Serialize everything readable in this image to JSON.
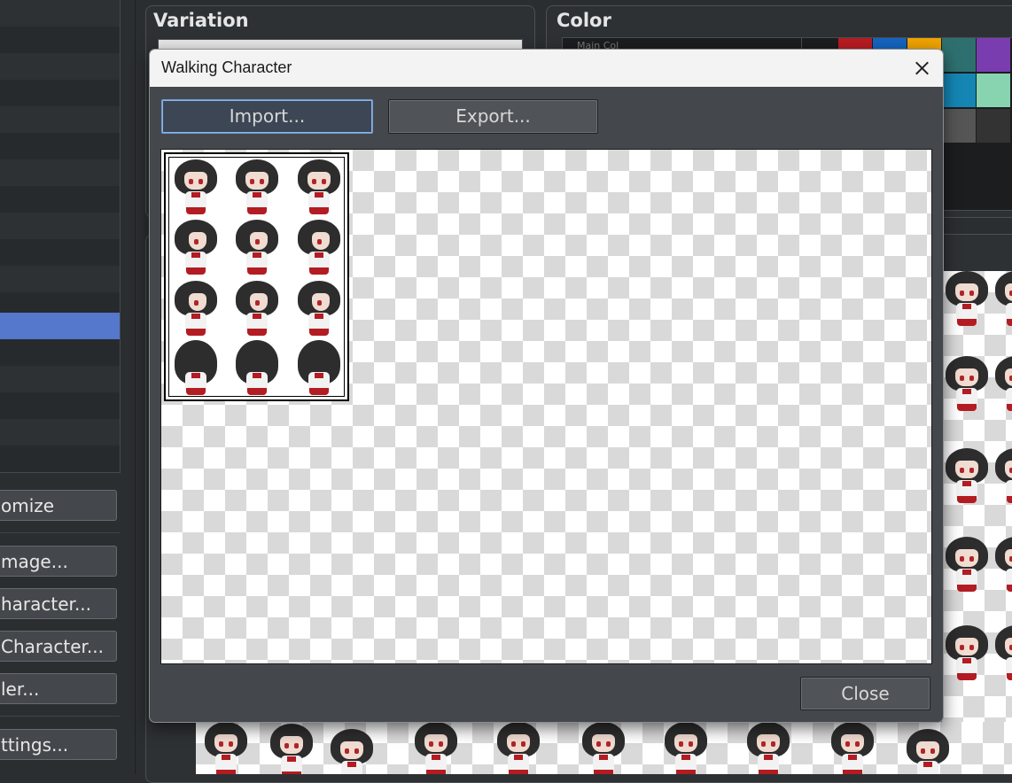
{
  "sidebar": {
    "buttons": [
      {
        "label": "omize"
      },
      {
        "label": "mage..."
      },
      {
        "label": "haracter..."
      },
      {
        "label": "Character..."
      },
      {
        "label": "ler..."
      },
      {
        "label": "ttings..."
      }
    ]
  },
  "panels": {
    "variation_title": "Variation",
    "color_title": "Color",
    "color_field_text": "Main Col",
    "swatches": [
      "#b81c22",
      "#1565c0",
      "#f0a400",
      "#2e7070",
      "#7a3db0",
      "#1586b4",
      "#89d4b0",
      "#555555",
      "#333333"
    ]
  },
  "dialog": {
    "title": "Walking Character",
    "import_label": "Import...",
    "export_label": "Export...",
    "close_label": "Close"
  }
}
